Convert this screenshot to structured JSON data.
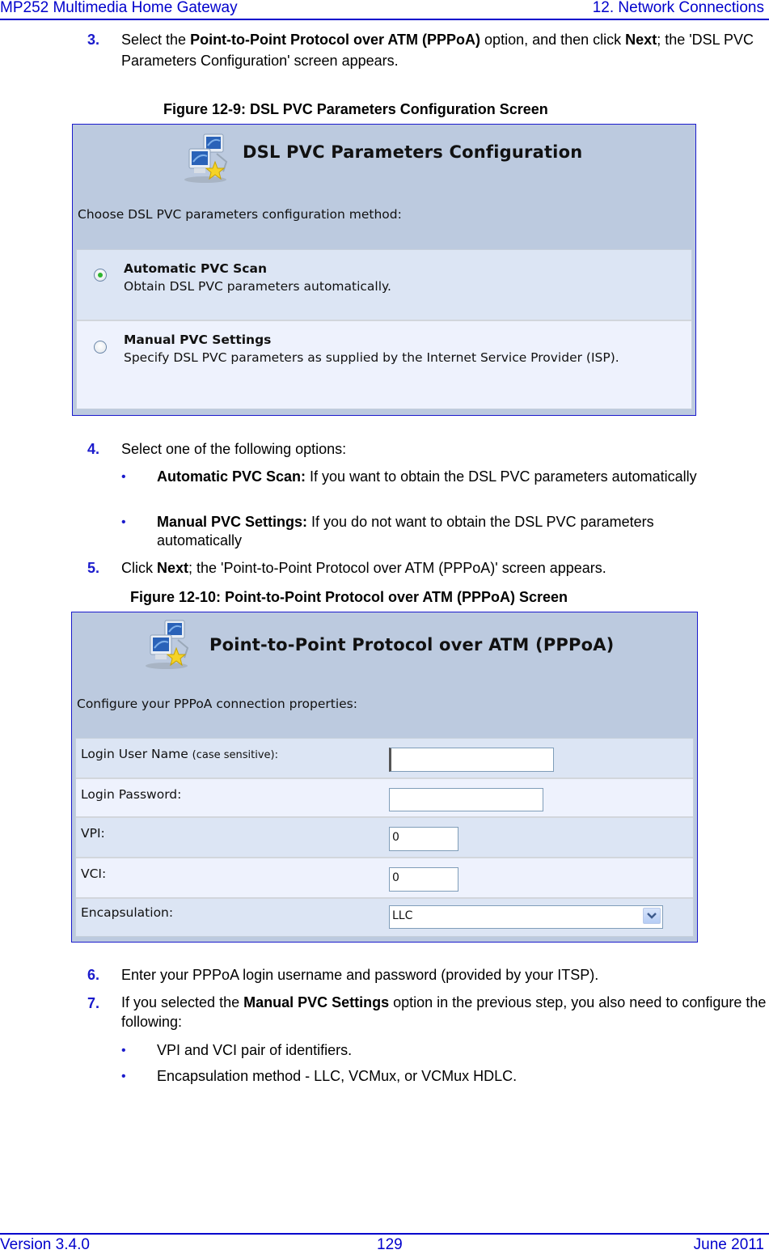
{
  "header": {
    "doc_title": "MP252 Multimedia Home Gateway",
    "chapter": "12. Network Connections"
  },
  "footer": {
    "version": "Version 3.4.0",
    "page": "129",
    "date": "June 2011"
  },
  "steps": [
    {
      "num": "3.",
      "parts": [
        "Select the ",
        "Point-to-Point Protocol over ATM (PPPoA)",
        " option, and then click ",
        "Next",
        "; the 'DSL PVC Parameters Configuration' screen appears."
      ]
    },
    {
      "num": "4.",
      "text": "Select one of the following options:"
    },
    {
      "num": "5.",
      "parts": [
        "Click ",
        "Next",
        "; the 'Point-to-Point Protocol over ATM (PPPoA)' screen appears."
      ]
    },
    {
      "num": "6.",
      "text": "Enter your PPPoA login username and password (provided by your ITSP)."
    },
    {
      "num": "7.",
      "parts": [
        "If you selected the ",
        "Manual PVC Settings",
        " option in the previous step, you also need to configure the following:"
      ]
    }
  ],
  "step4_bullets": [
    {
      "bold": "Automatic PVC Scan:",
      "text": " If you want to obtain the DSL PVC parameters automatically"
    },
    {
      "bold": "Manual PVC Settings:",
      "text": " If you do not want to obtain the DSL PVC parameters automatically"
    }
  ],
  "step7_bullets": [
    {
      "text": "VPI and VCI pair of identifiers."
    },
    {
      "text": "Encapsulation method - LLC, VCMux, or VCMux HDLC."
    }
  ],
  "bullet_glyph": "•",
  "figure1": {
    "caption": "Figure 12-9: DSL PVC Parameters Configuration Screen",
    "title": "DSL PVC Parameters Configuration",
    "icon": "network-computers-star-icon",
    "subtitle": "Choose DSL PVC parameters configuration method:",
    "options": [
      {
        "title": "Automatic PVC Scan",
        "desc": "Obtain DSL PVC parameters automatically.",
        "selected": true
      },
      {
        "title": "Manual PVC Settings",
        "desc": "Specify DSL PVC parameters as supplied by the Internet Service Provider (ISP).",
        "selected": false
      }
    ]
  },
  "figure2": {
    "caption": "Figure 12-10: Point-to-Point Protocol over ATM (PPPoA) Screen",
    "title": "Point-to-Point Protocol over ATM (PPPoA)",
    "icon": "network-computers-star-icon",
    "subtitle": "Configure your PPPoA connection properties:",
    "fields": {
      "username": {
        "label": "Login User Name",
        "hint": "(case sensitive):",
        "value": ""
      },
      "password": {
        "label": "Login Password:",
        "value": ""
      },
      "vpi": {
        "label": "VPI:",
        "value": "0"
      },
      "vci": {
        "label": "VCI:",
        "value": "0"
      },
      "encapsulation": {
        "label": "Encapsulation:",
        "value": "LLC"
      }
    }
  },
  "colors": {
    "accent_blue": "#0000cc",
    "figure_bg": "#bccadf",
    "row_dark": "#dce5f4",
    "row_light": "#eef2fd",
    "radio_selected": "#2fb52f"
  }
}
